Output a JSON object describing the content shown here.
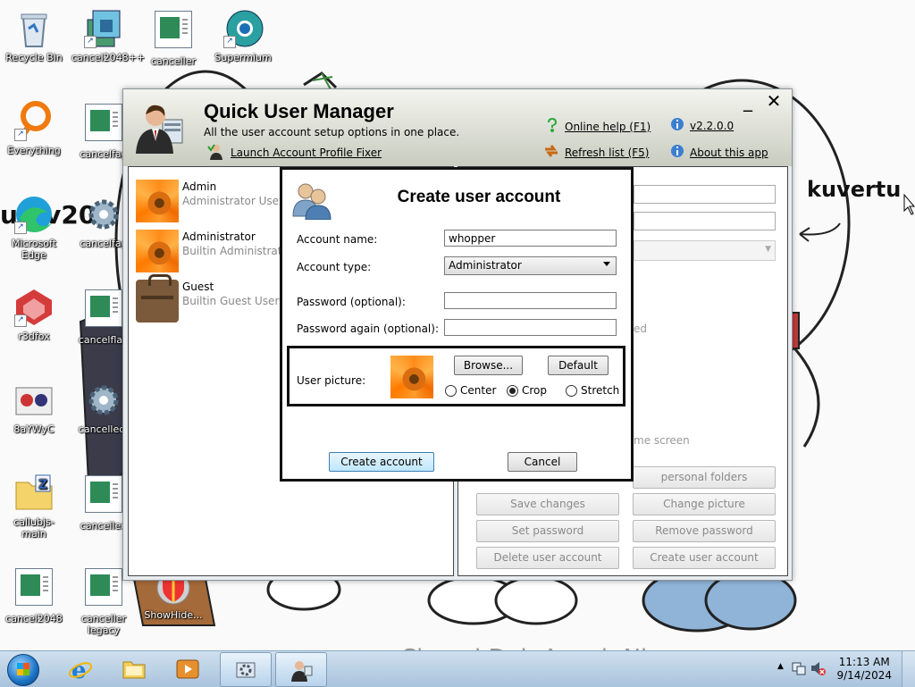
{
  "desktop": {
    "icons": [
      {
        "label": "Recycle Bin",
        "icon": "recycle-bin-icon"
      },
      {
        "label": "cancel2048++",
        "icon": "installer-icon"
      },
      {
        "label": "canceller",
        "icon": "document-icon"
      },
      {
        "label": "Supermium",
        "icon": "browser-icon"
      },
      {
        "label": "Everything",
        "icon": "search-icon"
      },
      {
        "label": "cancelfag",
        "icon": "document-icon"
      },
      {
        "label": "Microsoft Edge",
        "icon": "edge-icon"
      },
      {
        "label": "cancelfag",
        "icon": "gear-icon"
      },
      {
        "label": "r3dfox",
        "icon": "browser-icon"
      },
      {
        "label": "cancelflap",
        "icon": "document-icon"
      },
      {
        "label": "8aYWyC",
        "icon": "document-icon"
      },
      {
        "label": "cancelled-",
        "icon": "gear-icon"
      },
      {
        "label": "callubjs-main",
        "icon": "zip-folder-icon"
      },
      {
        "label": "cancelled",
        "icon": "document-icon"
      },
      {
        "label": "cancel2048",
        "icon": "document-icon"
      },
      {
        "label": "canceller legacy",
        "icon": "document-icon"
      },
      {
        "label": "ShowHide...",
        "icon": "shield-icon"
      }
    ],
    "wallpaper_text": {
      "kuvertu": "kuvertu",
      "partial": "ue:v20"
    }
  },
  "window": {
    "title": "Quick User Manager",
    "subtitle": "All the user account setup options in one place.",
    "profile_fixer_link": "Launch Account Profile Fixer",
    "online_help": "Online help (F1)",
    "version": "v2.2.0.0",
    "refresh_list": "Refresh list (F5)",
    "about": "About this app",
    "minimize": "_",
    "close": "✕"
  },
  "users": [
    {
      "name": "Admin",
      "description": "Administrator User",
      "picture": "flower"
    },
    {
      "name": "Administrator",
      "description": "Builtin Administrator",
      "picture": "flower"
    },
    {
      "name": "Guest",
      "description": "Builtin Guest User",
      "picture": "suitcase"
    }
  ],
  "right_panel": {
    "faded_text_1": "ed",
    "faded_text_2": "me screen",
    "faded_text_3": "t",
    "buttons": {
      "personal_folders": "personal folders",
      "save_changes": "Save changes",
      "change_picture": "Change picture",
      "set_password": "Set password",
      "remove_password": "Remove password",
      "delete_user": "Delete user account",
      "create_user": "Create user account"
    }
  },
  "dialog": {
    "title": "Create user account",
    "account_name_label": "Account name:",
    "account_name_value": "whopper",
    "account_type_label": "Account type:",
    "account_type_value": "Administrator",
    "password_label": "Password (optional):",
    "password_again_label": "Password again (optional):",
    "picture_label": "User picture:",
    "browse": "Browse...",
    "default": "Default",
    "radio_center": "Center",
    "radio_crop": "Crop",
    "radio_stretch": "Stretch",
    "selected_mode": "Crop",
    "create_button": "Create account",
    "cancel_button": "Cancel"
  },
  "taskbar": {
    "time": "11:13 AM",
    "date": "9/14/2024"
  }
}
